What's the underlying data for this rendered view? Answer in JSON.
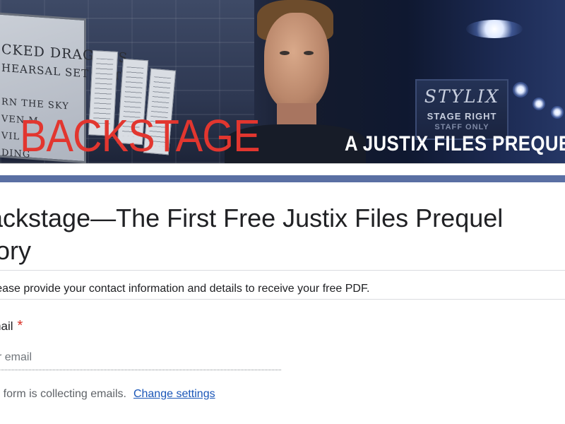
{
  "banner": {
    "title": "BACKSTAGE",
    "subtitle": "A JUSTIX FILES PREQUEL",
    "whiteboard_lines": [
      "CKED DRAGONS",
      "HEARSAL SET LIST",
      "RN THE SKY",
      "VEN M",
      "VIL I",
      "DING"
    ],
    "sign_title": "STYLIX",
    "sign_line1": "STAGE RIGHT",
    "sign_line2": "STAFF ONLY",
    "accent_color": "#5a6fa3",
    "title_color": "#e2362f"
  },
  "form": {
    "title": "Backstage—The First Free Justix Files Prequel Story",
    "description": "Please provide your contact information and details to receive your free PDF.",
    "question": {
      "label": "Email",
      "required_marker": "*",
      "placeholder": "Your email"
    },
    "collecting_note": "This form is collecting emails.",
    "change_settings_label": "Change settings",
    "link_color": "#1a56b8",
    "required_color": "#d93025"
  }
}
